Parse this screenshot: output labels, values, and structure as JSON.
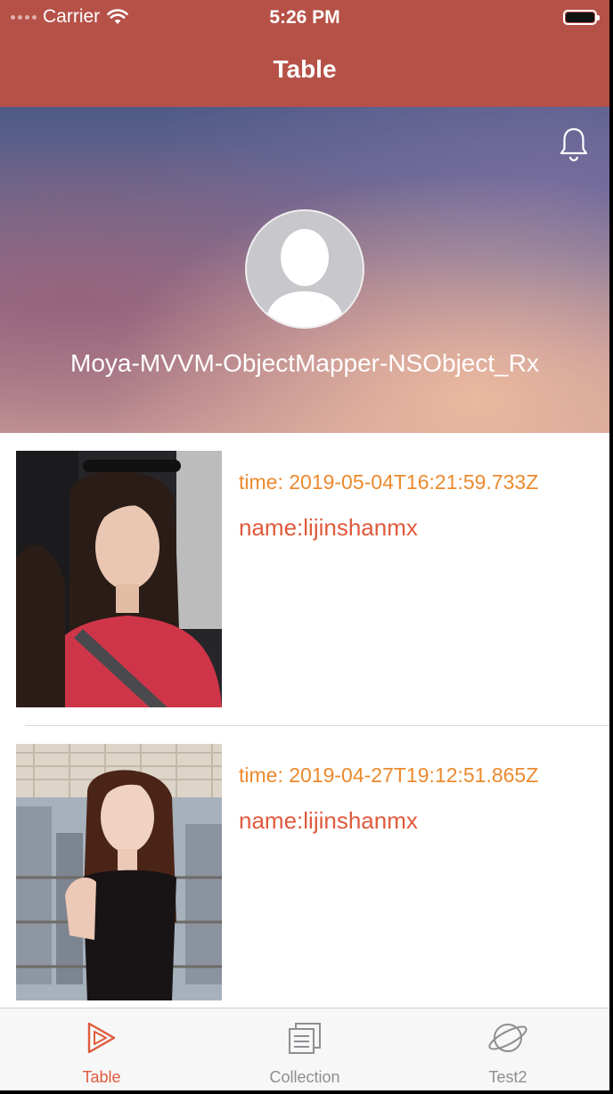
{
  "status_bar": {
    "carrier": "Carrier",
    "time": "5:26 PM"
  },
  "nav": {
    "title": "Table"
  },
  "header": {
    "name": "Moya-MVVM-ObjectMapper-NSObject_Rx",
    "icon": "bell-icon"
  },
  "rows": [
    {
      "time": "time: 2019-05-04T16:21:59.733Z",
      "name": "name:lijinshanmx"
    },
    {
      "time": "time: 2019-04-27T19:12:51.865Z",
      "name": "name:lijinshanmx"
    }
  ],
  "tabs": [
    {
      "label": "Table",
      "icon": "play-triangle-icon",
      "selected": true
    },
    {
      "label": "Collection",
      "icon": "stacked-pages-icon",
      "selected": false
    },
    {
      "label": "Test2",
      "icon": "planet-icon",
      "selected": false
    }
  ],
  "colors": {
    "nav_bg": "#b65148",
    "time_text": "#eb8a2e",
    "name_text": "#e05a3c",
    "tab_selected": "#e05a3c",
    "tab_unselected": "#8e8e93"
  }
}
